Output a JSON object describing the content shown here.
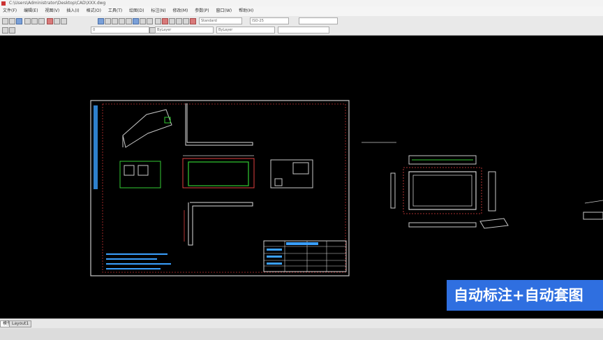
{
  "window": {
    "title": "C:\\Users\\Administrator\\Desktop\\CAD\\XXX.dwg"
  },
  "menu": {
    "items": [
      "文件(F)",
      "编辑(E)",
      "视图(V)",
      "插入(I)",
      "格式(O)",
      "工具(T)",
      "绘图(D)",
      "标注(N)",
      "修改(M)",
      "参数(P)",
      "窗口(W)",
      "帮助(H)"
    ]
  },
  "toolbar": {
    "layer_combo": "0",
    "linetype_combo": "ByLayer",
    "color_combo": "ByLayer",
    "style_combo": "Standard",
    "dim_combo": "ISO-25"
  },
  "layout_tabs": [
    "模型",
    "Layout1"
  ],
  "banner": {
    "text": "自动标注+自动套图"
  },
  "colors": {
    "banner_bg": "#2f6fe0",
    "canvas_bg": "#000000"
  }
}
